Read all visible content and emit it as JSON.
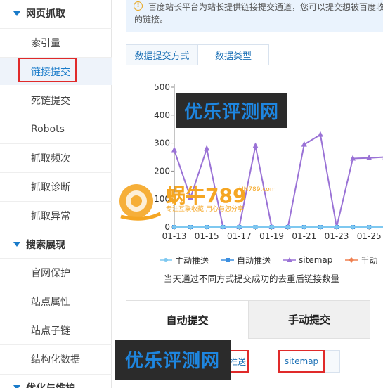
{
  "sidebar": {
    "sections": [
      {
        "label": "网页抓取"
      },
      {
        "label": "搜索展现"
      },
      {
        "label": "优化与维护"
      }
    ],
    "crawl_items": [
      {
        "label": "索引量"
      },
      {
        "label": "链接提交"
      },
      {
        "label": "死链提交"
      },
      {
        "label": "Robots"
      },
      {
        "label": "抓取频次"
      },
      {
        "label": "抓取诊断"
      },
      {
        "label": "抓取异常"
      }
    ],
    "display_items": [
      {
        "label": "官网保护"
      },
      {
        "label": "站点属性"
      },
      {
        "label": "站点子链"
      },
      {
        "label": "结构化数据"
      }
    ],
    "active_item": "链接提交"
  },
  "notice": {
    "line1": "百度站长平台为站长提供链接提交通道，您可以提交想被百度收",
    "line2": "的链接。"
  },
  "top_tabs": {
    "method": "数据提交方式",
    "type": "数据类型"
  },
  "legend": {
    "items": [
      "主动推送",
      "自动推送",
      "sitemap",
      "手动"
    ]
  },
  "caption": "当天通过不同方式提交成功的去重后链接数量",
  "big_tabs": {
    "auto": "自动提交",
    "manual": "手动提交"
  },
  "sub_tabs": {
    "push": "推送",
    "sitemap": "sitemap"
  },
  "watermarks": {
    "top": "优乐评测网",
    "bottom": "优乐评测网"
  },
  "logo": {
    "name": "蜗牛789",
    "domain": "UN789.com",
    "slogan": "专注互联收藏  用心与您分享"
  },
  "colors": {
    "accent": "#1a7bc9",
    "highlight_red": "#e02a2a",
    "series_sitemap": "#9a72d6",
    "series_auto": "#3c8fe0",
    "series_active": "#7ec8f0",
    "series_manual": "#f08050"
  },
  "chart_data": {
    "type": "line",
    "x": [
      "01-13",
      "01-14",
      "01-15",
      "01-16",
      "01-17",
      "01-18",
      "01-19",
      "01-20",
      "01-21",
      "01-22",
      "01-23",
      "01-24",
      "01-25",
      "01-26"
    ],
    "xticks": [
      "01-13",
      "01-15",
      "01-17",
      "01-19",
      "01-21",
      "01-23",
      "01-25"
    ],
    "ylim": [
      0,
      500
    ],
    "yticks": [
      0,
      100,
      200,
      300,
      400,
      500
    ],
    "series": [
      {
        "name": "sitemap",
        "values": [
          275,
          105,
          280,
          0,
          0,
          290,
          0,
          0,
          295,
          330,
          0,
          245,
          247,
          250
        ]
      },
      {
        "name": "自动推送",
        "values": [
          0,
          0,
          0,
          0,
          0,
          0,
          0,
          0,
          0,
          0,
          0,
          0,
          0,
          0
        ]
      },
      {
        "name": "主动推送",
        "values": [
          0,
          0,
          0,
          0,
          0,
          0,
          0,
          0,
          0,
          0,
          0,
          0,
          0,
          0
        ]
      }
    ]
  }
}
